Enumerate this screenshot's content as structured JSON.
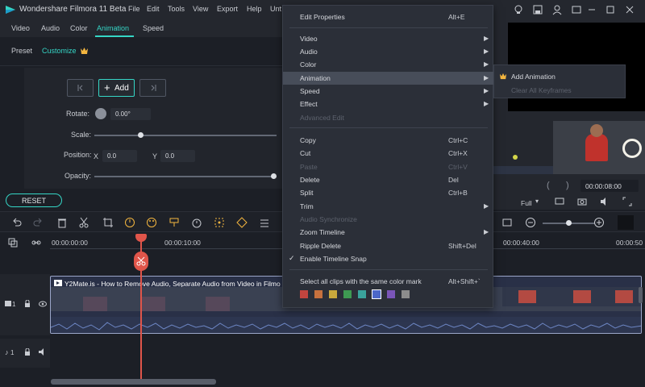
{
  "app": {
    "title": "Wondershare Filmora 11 Beta"
  },
  "menubar": {
    "items": [
      "File",
      "Edit",
      "Tools",
      "View",
      "Export",
      "Help",
      "Unt"
    ]
  },
  "edit_tabs": [
    "Video",
    "Audio",
    "Color",
    "Animation",
    "Speed"
  ],
  "sub_tabs": [
    "Preset",
    "Customize"
  ],
  "keyframe": {
    "add_label": "Add"
  },
  "properties": {
    "rotate_label": "Rotate:",
    "rotate_value": "0.00°",
    "scale_label": "Scale:",
    "position_label": "Position:",
    "x_label": "X",
    "x_value": "0.0",
    "y_label": "Y",
    "y_value": "0.0",
    "opacity_label": "Opacity:"
  },
  "reset_label": "RESET",
  "preview": {
    "timecode": "00:00:08:00",
    "quality": "Full"
  },
  "ruler": {
    "timecodes": [
      "00:00:00:00",
      "00:00:10:00",
      "00:00:40:00",
      "00:00:50"
    ]
  },
  "clip": {
    "title": "Y2Mate.is - How to Remove Audio, Separate Audio from Video in Filmo"
  },
  "tracks": {
    "video_label": "1",
    "audio_label": "1"
  },
  "context_menu": {
    "items": [
      {
        "label": "Edit Properties",
        "shortcut": "Alt+E"
      },
      {
        "label": "Video",
        "submenu": true
      },
      {
        "label": "Audio",
        "submenu": true
      },
      {
        "label": "Color",
        "submenu": true
      },
      {
        "label": "Animation",
        "submenu": true
      },
      {
        "label": "Speed",
        "submenu": true
      },
      {
        "label": "Effect",
        "submenu": true
      },
      {
        "label": "Advanced Edit"
      },
      {
        "label": "Copy",
        "shortcut": "Ctrl+C"
      },
      {
        "label": "Cut",
        "shortcut": "Ctrl+X"
      },
      {
        "label": "Paste",
        "shortcut": "Ctrl+V"
      },
      {
        "label": "Delete",
        "shortcut": "Del"
      },
      {
        "label": "Split",
        "shortcut": "Ctrl+B"
      },
      {
        "label": "Trim",
        "submenu": true
      },
      {
        "label": "Audio Synchronize"
      },
      {
        "label": "Zoom Timeline",
        "submenu": true
      },
      {
        "label": "Ripple Delete",
        "shortcut": "Shift+Del"
      },
      {
        "label": "Enable Timeline Snap"
      },
      {
        "label": "Select all clips with the same color mark",
        "shortcut": "Alt+Shift+`"
      }
    ],
    "swatch_colors": [
      "#c1453f",
      "#c6713e",
      "#c8a83c",
      "#3e9a52",
      "#3aa39c",
      "#4c67c8",
      "#7a55b8",
      "#8c8c8c"
    ]
  },
  "submenu": {
    "add_animation": "Add Animation",
    "clear_keyframes": "Clear All Keyframes"
  },
  "colors": {
    "accent": "#35d6c6",
    "playhead": "#e0554a",
    "premium": "#f4b63f"
  }
}
